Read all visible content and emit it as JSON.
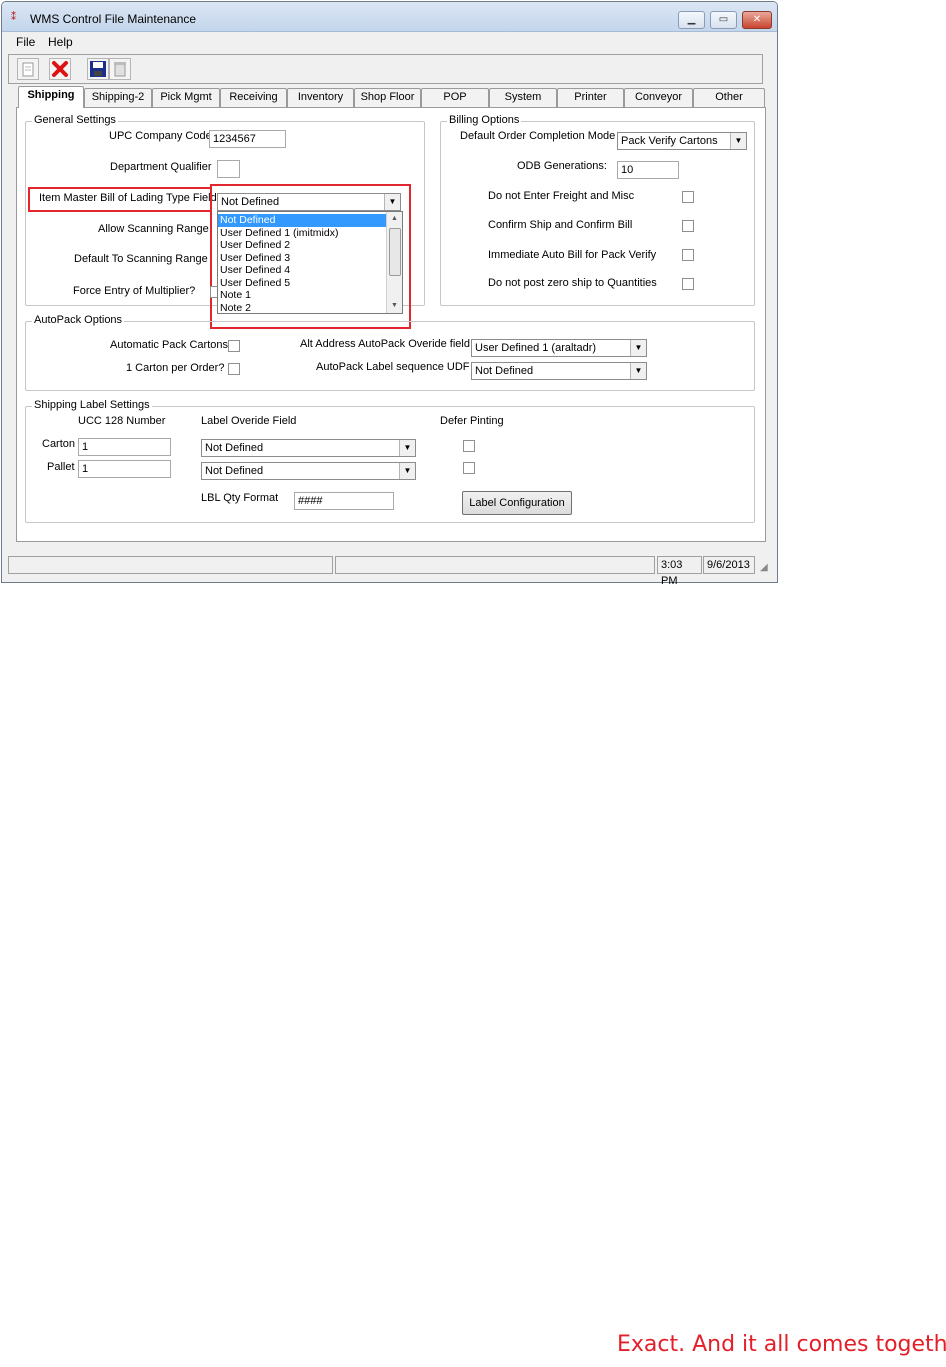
{
  "window": {
    "title": "WMS Control File Maintenance"
  },
  "menu": [
    {
      "label": "File"
    },
    {
      "label": "Help"
    }
  ],
  "tabs": [
    {
      "label": "Shipping"
    },
    {
      "label": "Shipping-2"
    },
    {
      "label": "Pick Mgmt"
    },
    {
      "label": "Receiving"
    },
    {
      "label": "Inventory"
    },
    {
      "label": "Shop Floor"
    },
    {
      "label": "POP"
    },
    {
      "label": "System"
    },
    {
      "label": "Printer"
    },
    {
      "label": "Conveyor"
    },
    {
      "label": "Other"
    }
  ],
  "general": {
    "title": "General Settings",
    "upc_label": "UPC Company Code",
    "upc_value": "1234567",
    "dept_label": "Department Qualifier",
    "dept_value": "",
    "bol_label": "Item Master Bill of Lading Type Field",
    "bol_value": "Not Defined",
    "scan_range_label": "Allow Scanning Range",
    "default_scan_label": "Default To Scanning Range",
    "force_mult_label": "Force Entry of Multiplier?",
    "bol_options": [
      {
        "label": "Not Defined"
      },
      {
        "label": "User Defined 1 (imitmidx)"
      },
      {
        "label": "User Defined 2"
      },
      {
        "label": "User Defined 3"
      },
      {
        "label": "User Defined 4"
      },
      {
        "label": "User Defined 5"
      },
      {
        "label": "Note 1"
      },
      {
        "label": "Note 2"
      }
    ]
  },
  "billing": {
    "title": "Billing Options",
    "completion_label": "Default Order Completion Mode",
    "completion_value": "Pack Verify Cartons",
    "odb_label": "ODB Generations:",
    "odb_value": "10",
    "freight_label": "Do not Enter Freight and Misc",
    "confirm_label": "Confirm Ship and Confirm Bill",
    "auto_bill_label": "Immediate Auto Bill for Pack Verify",
    "zero_ship_label": "Do not post zero ship to Quantities"
  },
  "autopack": {
    "title": "AutoPack Options",
    "auto_cartons_label": "Automatic Pack Cartons",
    "one_carton_label": "1  Carton per Order?",
    "alt_address_label": "Alt Address AutoPack Overide field",
    "alt_address_value": "User Defined 1 (araltadr)",
    "label_seq_label": "AutoPack Label sequence UDF",
    "label_seq_value": "Not Defined"
  },
  "shipping_label": {
    "title": "Shipping Label Settings",
    "ucc_header": "UCC 128 Number",
    "override_header": "Label Overide Field",
    "defer_header": "Defer Pinting",
    "carton_label": "Carton",
    "carton_ucc": "1",
    "carton_override": "Not Defined",
    "pallet_label": "Pallet",
    "pallet_ucc": "1",
    "pallet_override": "Not Defined",
    "qty_format_label": "LBL Qty Format",
    "qty_format_value": "####",
    "config_button": "Label Configuration"
  },
  "statusbar": {
    "time": "3:03 PM",
    "date": "9/6/2013"
  },
  "tagline": "Exact. And it all comes together.",
  "colors": {
    "highlight_box": "#e2262d",
    "selection": "#3399ff",
    "tagline": "#e3202a"
  },
  "icons": [
    "new-icon",
    "delete-icon",
    "save-icon",
    "trash-icon"
  ]
}
